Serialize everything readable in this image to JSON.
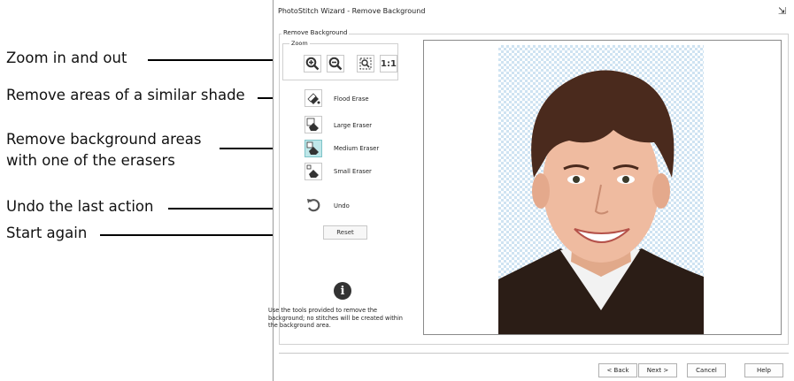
{
  "callouts": {
    "zoom": "Zoom in and out",
    "flood": "Remove areas of a similar shade",
    "erasers_line1": "Remove background areas",
    "erasers_line2": "with one of the erasers",
    "undo": "Undo the last action",
    "start": "Start again"
  },
  "window": {
    "title": "PhotoStitch Wizard - Remove Background",
    "group_label": "Remove Background",
    "zoom_label": "Zoom",
    "zoom_buttons": [
      {
        "icon": "zoom-in-icon"
      },
      {
        "icon": "zoom-out-icon"
      },
      {
        "icon": "zoom-fit-icon"
      },
      {
        "label": "1:1",
        "icon": "zoom-actual-size-icon"
      }
    ],
    "tools": {
      "flood": "Flood Erase",
      "large": "Large Eraser",
      "medium": "Medium Eraser",
      "small": "Small Eraser",
      "undo": "Undo",
      "reset": "Reset"
    },
    "selected_tool": "medium",
    "info_icon": "i",
    "info_text": "Use the tools provided to remove the background; no stitches will be created within the background area.",
    "buttons": {
      "back": "< Back",
      "next": "Next >",
      "cancel": "Cancel",
      "help": "Help"
    },
    "colors": {
      "selected_tool": "#bfe7e9",
      "transparent_check": "#cfe3f2"
    }
  }
}
